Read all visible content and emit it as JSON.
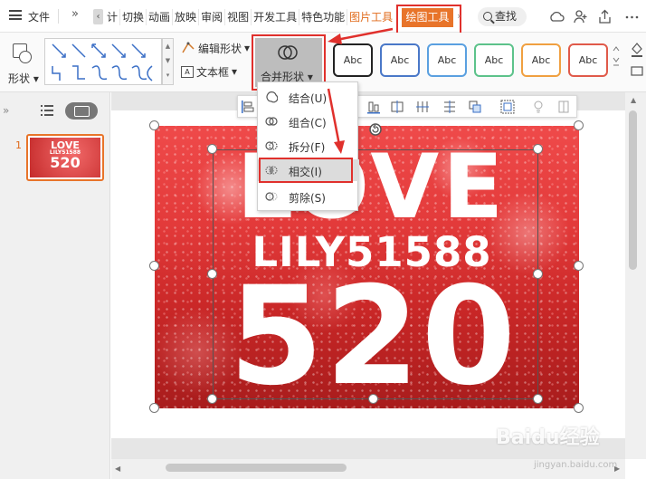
{
  "menubar": {
    "file_label": "文件",
    "more_label": "»",
    "tabs": [
      "计",
      "切换",
      "动画",
      "放映",
      "审阅",
      "视图",
      "开发工具",
      "特色功能",
      "图片工具"
    ],
    "active_tab": "绘图工具",
    "search_label": "查找"
  },
  "ribbon": {
    "shape_label": "形状",
    "edit_shape_label": "编辑形状",
    "textbox_label": "文本框",
    "merge_label": "合并形状",
    "style_boxes": [
      {
        "label": "Abc",
        "color": "#222222"
      },
      {
        "label": "Abc",
        "color": "#4a78c8"
      },
      {
        "label": "Abc",
        "color": "#5aa0e0"
      },
      {
        "label": "Abc",
        "color": "#5cc28a"
      },
      {
        "label": "Abc",
        "color": "#f0a040"
      },
      {
        "label": "Abc",
        "color": "#e05a4a"
      }
    ]
  },
  "dropdown": {
    "items": [
      {
        "label": "结合(U)"
      },
      {
        "label": "组合(C)"
      },
      {
        "label": "拆分(F)"
      },
      {
        "label": "相交(I)"
      },
      {
        "label": "剪除(S)"
      }
    ]
  },
  "slides_panel": {
    "slide_number": "1",
    "thumb_line1": "LOVE",
    "thumb_line2": "LILY51588",
    "thumb_line3": "520"
  },
  "slide": {
    "line1": "LOVE",
    "line2": "LILY51588",
    "line3": "520"
  },
  "watermark": {
    "brand": "Baidu经验",
    "url": "jingyan.baidu.com"
  },
  "colors": {
    "accent_orange": "#e8742a",
    "highlight_red": "#e0302c"
  }
}
